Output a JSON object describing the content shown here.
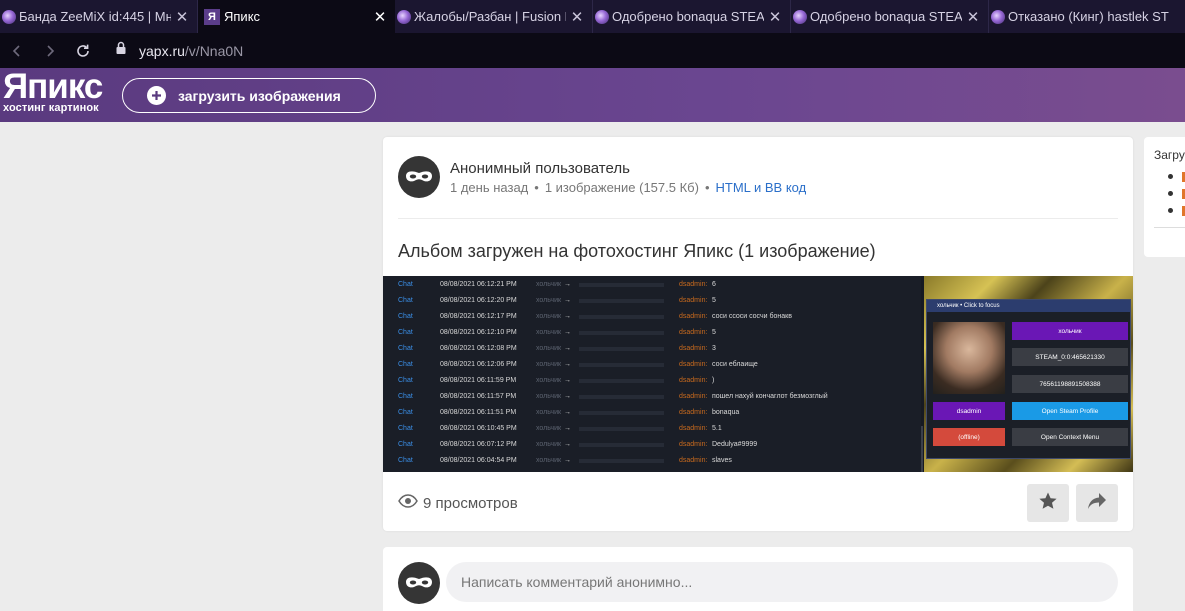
{
  "browser": {
    "tabs": [
      {
        "title": "Банда ZeeMiX id:445 | Мно",
        "favicon": "fusion-icon",
        "active": false
      },
      {
        "title": "Япикс",
        "favicon": "yapx-icon",
        "favicon_text": "Я",
        "active": true
      },
      {
        "title": "Жалобы/Разбан | Fusion R",
        "favicon": "fusion-icon",
        "active": false
      },
      {
        "title": "Одобрено bonaqua STEAM",
        "favicon": "fusion-icon",
        "active": false
      },
      {
        "title": "Одобрено bonaqua STEAM",
        "favicon": "fusion-icon",
        "active": false
      },
      {
        "title": "Отказано (Кинг) hastlek ST",
        "favicon": "fusion-icon",
        "active": false
      }
    ],
    "url_host": "yapx.ru",
    "url_path": "/v/Nna0N"
  },
  "site": {
    "logo": "Япикс",
    "tagline": "хостинг картинок",
    "upload_label": "загрузить изображения"
  },
  "post": {
    "user_name": "Анонимный пользователь",
    "time_ago": "1 день назад",
    "image_count": "1 изображение",
    "size": "(157.5 Кб)",
    "code_link": "HTML и BB код",
    "album_title": "Альбом загружен на фотохостинг Япикс (1 изображение)",
    "views": "9 просмотров"
  },
  "screenshot": {
    "chat_rows": [
      {
        "channel": "Chat",
        "time": "08/08/2021 06:12:21 PM",
        "from": "хольчик",
        "to": "dsadmin:",
        "message": "6"
      },
      {
        "channel": "Chat",
        "time": "08/08/2021 06:12:20 PM",
        "from": "хольчик",
        "to": "dsadmin:",
        "message": "5"
      },
      {
        "channel": "Chat",
        "time": "08/08/2021 06:12:17 PM",
        "from": "хольчик",
        "to": "dsadmin:",
        "message": "соси сcоси сосчи бонакв"
      },
      {
        "channel": "Chat",
        "time": "08/08/2021 06:12:10 PM",
        "from": "хольчик",
        "to": "dsadmin:",
        "message": "5"
      },
      {
        "channel": "Chat",
        "time": "08/08/2021 06:12:08 PM",
        "from": "хольчик",
        "to": "dsadmin:",
        "message": "3"
      },
      {
        "channel": "Chat",
        "time": "08/08/2021 06:12:06 PM",
        "from": "хольчик",
        "to": "dsadmin:",
        "message": "соси еблаище"
      },
      {
        "channel": "Chat",
        "time": "08/08/2021 06:11:59 PM",
        "from": "хольчик",
        "to": "dsadmin:",
        "message": ")"
      },
      {
        "channel": "Chat",
        "time": "08/08/2021 06:11:57 PM",
        "from": "хольчик",
        "to": "dsadmin:",
        "message": "пошел нахуй кончаглот безмозглый"
      },
      {
        "channel": "Chat",
        "time": "08/08/2021 06:11:51 PM",
        "from": "хольчик",
        "to": "dsadmin:",
        "message": "bonaqua"
      },
      {
        "channel": "Chat",
        "time": "08/08/2021 06:10:45 PM",
        "from": "хольчик",
        "to": "dsadmin:",
        "message": "5.1"
      },
      {
        "channel": "Chat",
        "time": "08/08/2021 06:07:12 PM",
        "from": "хольчик",
        "to": "dsadmin:",
        "message": "Dedulya#9999"
      },
      {
        "channel": "Chat",
        "time": "08/08/2021 06:04:54 PM",
        "from": "хольчик",
        "to": "dsadmin:",
        "message": "slaves"
      }
    ],
    "popup": {
      "title": "хольчик • Click to focus",
      "name_btn": "хольчик",
      "steam_id": "STEAM_0:0:465621330",
      "steam_id64": "76561198891508388",
      "admin_btn": "dsadmin",
      "open_profile": "Open Steam Profile",
      "status": "(offline)",
      "context_menu": "Open Context Menu"
    }
  },
  "comment": {
    "placeholder": "Написать комментарий анонимно..."
  },
  "sidebar": {
    "title": "Загру"
  },
  "colors": {
    "header_purple": "#6a4690",
    "link_blue": "#2b6fc9",
    "tab_bg": "#1b1630"
  }
}
